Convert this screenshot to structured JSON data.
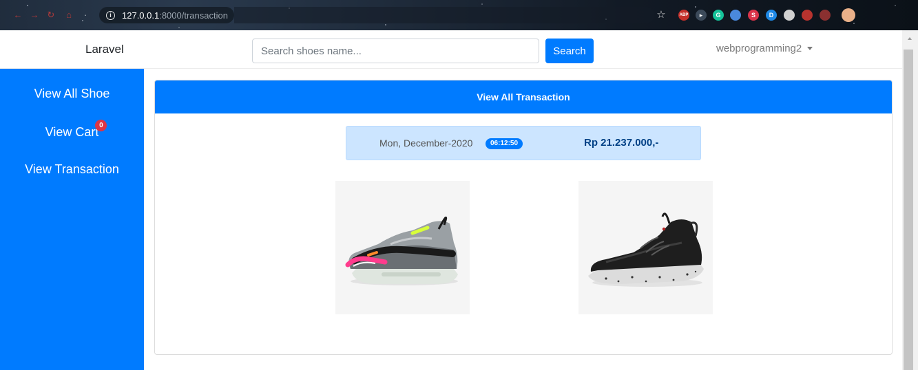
{
  "browser": {
    "url_host": "127.0.0.1",
    "url_rest": ":8000/transaction",
    "extensions": [
      {
        "name": "star-icon",
        "label": "☆",
        "color": "#e0e0e0"
      },
      {
        "name": "adblock-icon",
        "label": "ABP",
        "color": "#c4302b"
      },
      {
        "name": "cursor-extension-icon",
        "label": "▸",
        "color": "#3c4a5a"
      },
      {
        "name": "grammarly-icon",
        "label": "G",
        "color": "#15c39a"
      },
      {
        "name": "translate-icon",
        "label": "",
        "color": "#4a89dc"
      },
      {
        "name": "s-extension-icon",
        "label": "S",
        "color": "#d9344a"
      },
      {
        "name": "d-extension-icon",
        "label": "D",
        "color": "#1e88e5"
      },
      {
        "name": "globe-icon",
        "label": "",
        "color": "#d0d0d0"
      },
      {
        "name": "puzzle-icon",
        "label": "",
        "color": "#b8332e"
      },
      {
        "name": "pin-icon",
        "label": "",
        "color": "#8a3030"
      },
      {
        "name": "profile-avatar-icon",
        "label": "",
        "color": "#e9b089"
      }
    ]
  },
  "navbar": {
    "brand": "Laravel",
    "search_placeholder": "Search shoes name...",
    "search_button": "Search",
    "user": "webprogramming2"
  },
  "sidebar": {
    "items": [
      {
        "label": "View All Shoe"
      },
      {
        "label": "View Cart",
        "badge": "0"
      },
      {
        "label": "View Transaction"
      }
    ]
  },
  "main": {
    "header": "View All Transaction",
    "transaction": {
      "date": "Mon, December-2020",
      "time": "06:12:50",
      "total": "Rp 21.237.000,-"
    },
    "products": [
      {
        "icon": "pink-grey-sneaker-icon"
      },
      {
        "icon": "black-sneaker-icon"
      }
    ]
  },
  "colors": {
    "primary": "#007bff",
    "badge": "#dc3545",
    "alert_bg": "#cce5ff",
    "alert_text": "#004085"
  }
}
